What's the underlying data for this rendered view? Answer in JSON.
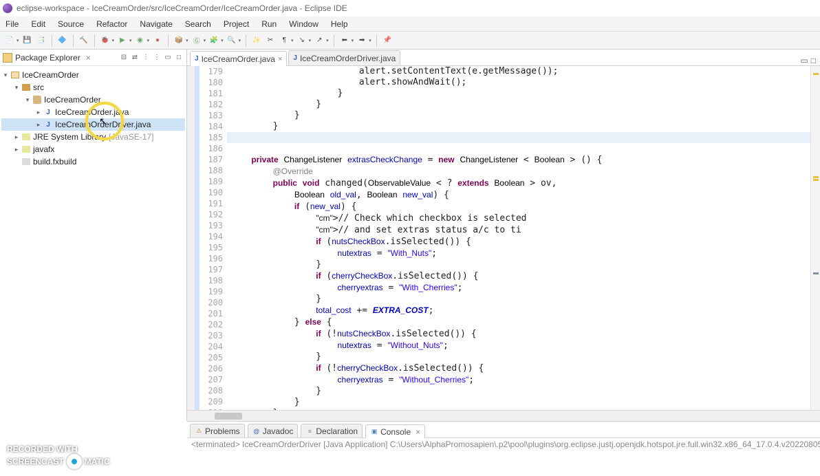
{
  "window": {
    "title": "eclipse-workspace - IceCreamOrder/src/IceCreamOrder/IceCreamOrder.java - Eclipse IDE"
  },
  "menus": [
    "File",
    "Edit",
    "Source",
    "Refactor",
    "Navigate",
    "Search",
    "Project",
    "Run",
    "Window",
    "Help"
  ],
  "sidebar": {
    "title": "Package Explorer",
    "items": [
      {
        "label": "IceCreamOrder",
        "kind": "project",
        "indent": 0,
        "arrow": "▾"
      },
      {
        "label": "src",
        "kind": "folder",
        "indent": 1,
        "arrow": "▾"
      },
      {
        "label": "IceCreamOrder",
        "kind": "package",
        "indent": 2,
        "arrow": "▾"
      },
      {
        "label": "IceCreamOrder.java",
        "kind": "java",
        "indent": 3,
        "arrow": "▸"
      },
      {
        "label": "IceCreamOrderDriver.java",
        "kind": "java",
        "indent": 3,
        "arrow": "▸",
        "selected": true
      },
      {
        "label": "JRE System Library",
        "extra": "[JavaSE-17]",
        "kind": "lib",
        "indent": 1,
        "arrow": "▸"
      },
      {
        "label": "javafx",
        "kind": "lib",
        "indent": 1,
        "arrow": "▸"
      },
      {
        "label": "build.fxbuild",
        "kind": "file",
        "indent": 1,
        "arrow": ""
      }
    ]
  },
  "editorTabs": [
    {
      "label": "IceCreamOrder.java",
      "active": true,
      "close": true
    },
    {
      "label": "IceCreamOrderDriver.java",
      "active": false,
      "close": false
    }
  ],
  "lineStart": 179,
  "lineEnd": 210,
  "code": [
    "                        alert.setContentText(e.getMessage());",
    "                        alert.showAndWait();",
    "                    }",
    "                }",
    "            }",
    "        }",
    "",
    "    private ChangeListener extrasCheckChange = new ChangeListener < Boolean > () {",
    "        @Override",
    "        public void changed(ObservableValue < ? extends Boolean > ov,",
    "            Boolean old_val, Boolean new_val) {",
    "            if (new_val) {",
    "                // Check which checkbox is selected",
    "                // and set extras status a/c to ti",
    "                if (nutsCheckBox.isSelected()) {",
    "                    nutextras = \"With_Nuts\";",
    "                }",
    "                if (cherryCheckBox.isSelected()) {",
    "                    cherryextras = \"With_Cherries\";",
    "                }",
    "                total_cost += EXTRA_COST;",
    "            } else {",
    "                if (!nutsCheckBox.isSelected()) {",
    "                    nutextras = \"Without_Nuts\";",
    "                }",
    "                if (!cherryCheckBox.isSelected()) {",
    "                    cherryextras = \"Without_Cherries\";",
    "                }",
    "            }",
    "        }",
    "    };",
    "}"
  ],
  "bottomTabs": [
    {
      "label": "Problems",
      "icon": "⚠",
      "iconColor": "#c08020"
    },
    {
      "label": "Javadoc",
      "icon": "@",
      "iconColor": "#3060c0"
    },
    {
      "label": "Declaration",
      "icon": "≡",
      "iconColor": "#888"
    },
    {
      "label": "Console",
      "icon": "▣",
      "iconColor": "#5080c0",
      "active": true,
      "close": true
    }
  ],
  "console": {
    "status": "<terminated> IceCreamOrderDriver [Java Application] C:\\Users\\AlphaPromosapien\\.p2\\pool\\plugins\\org.eclipse.justj.openjdk.hotspot.jre.full.win32.x86_64_17.0.4.v20220805-1"
  },
  "watermark": {
    "line1": "RECORDED WITH",
    "line2a": "SCREENCAST",
    "line2b": "MATIC"
  }
}
